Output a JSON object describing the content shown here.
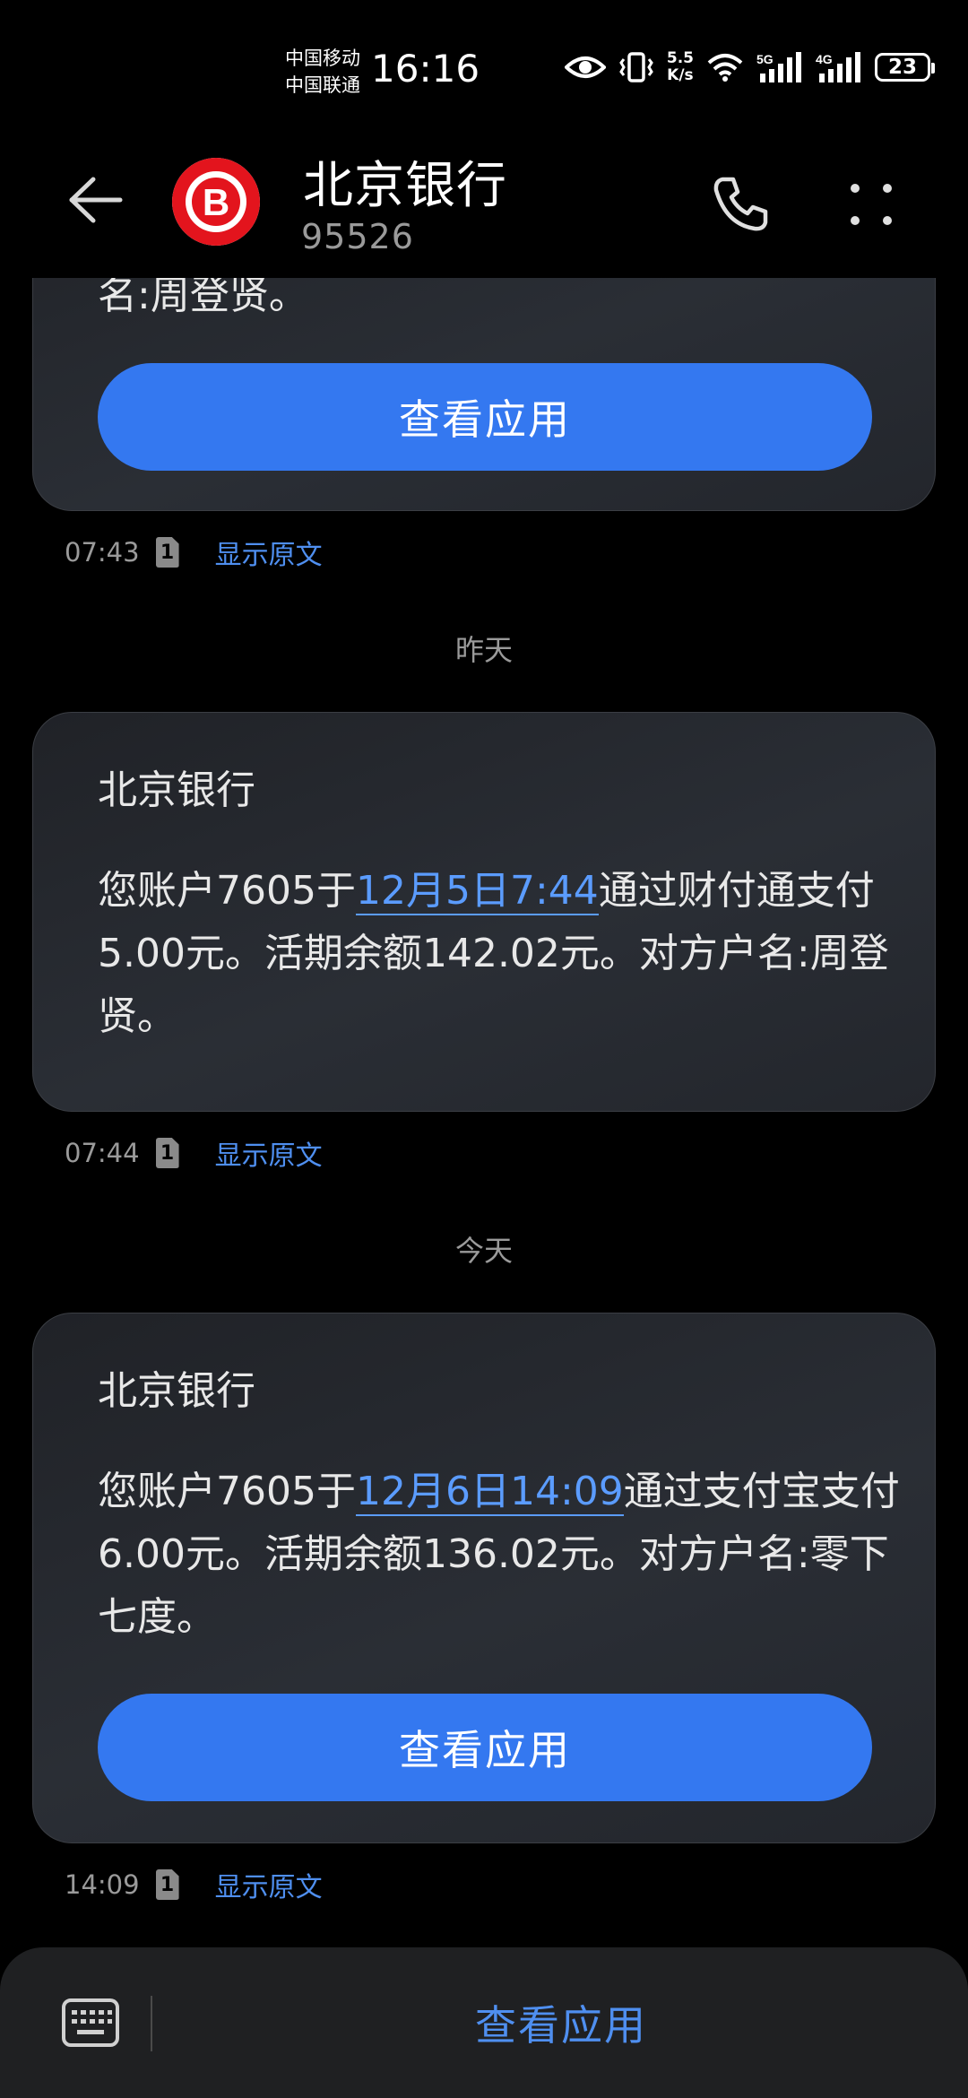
{
  "status_bar": {
    "carrier_1": "中国移动",
    "carrier_2": "中国联通",
    "time": "16:16",
    "net_speed_value": "5.5",
    "net_speed_unit": "K/s",
    "sim1_network": "5G",
    "sim2_network": "4G",
    "battery": "23",
    "icons": [
      "eye-comfort-icon",
      "vibrate-icon",
      "wifi-icon",
      "signal-5g-icon",
      "signal-4g-icon",
      "battery-icon"
    ]
  },
  "header": {
    "title": "北京银行",
    "number": "95526",
    "logo_letter": "B",
    "logo_color": "#e3141d",
    "icons": [
      "back-arrow-icon",
      "phone-icon",
      "more-icon"
    ]
  },
  "messages": [
    {
      "text_tail": "名:周登贤。",
      "button": "查看应用",
      "time": "07:43",
      "sim": "1",
      "show_original": "显示原文"
    },
    {
      "sender": "北京银行",
      "text_pre": "您账户7605于",
      "text_link": "12月5日7:44",
      "text_post": "通过财付通支付5.00元。活期余额142.02元。对方户名:周登贤。",
      "time": "07:44",
      "sim": "1",
      "show_original": "显示原文"
    },
    {
      "sender": "北京银行",
      "text_pre": "您账户7605于",
      "text_link": "12月6日14:09",
      "text_post": "通过支付宝支付6.00元。活期余额136.02元。对方户名:零下七度。",
      "button": "查看应用",
      "time": "14:09",
      "sim": "1",
      "show_original": "显示原文"
    }
  ],
  "date_separators": {
    "yesterday": "昨天",
    "today": "今天"
  },
  "bottom_bar": {
    "app_button": "查看应用",
    "accent_color": "#4f8ff0",
    "icons": [
      "keyboard-icon"
    ]
  }
}
